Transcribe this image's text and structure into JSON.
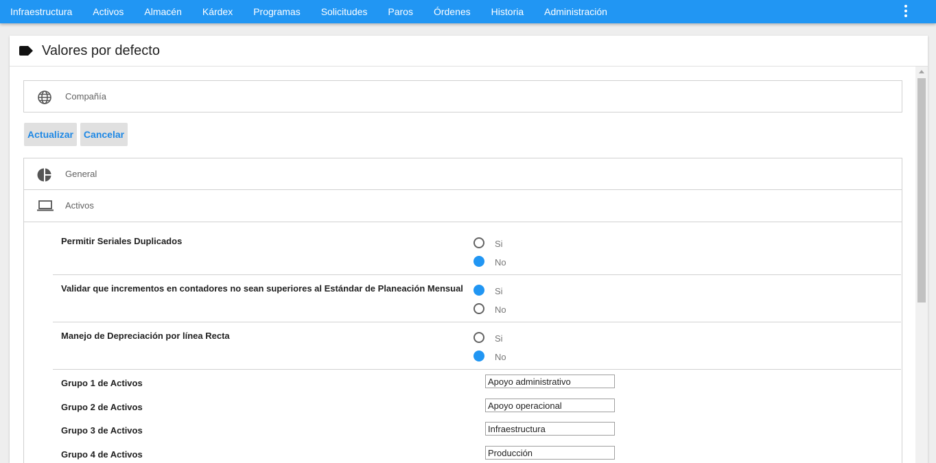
{
  "nav": {
    "items": [
      "Infraestructura",
      "Activos",
      "Almacén",
      "Kárdex",
      "Programas",
      "Solicitudes",
      "Paros",
      "Órdenes",
      "Historia",
      "Administración"
    ]
  },
  "page": {
    "title": "Valores por defecto"
  },
  "company_panel": {
    "label": "Compañía",
    "icon": "globe-icon"
  },
  "actions": {
    "update_label": "Actualizar",
    "cancel_label": "Cancelar"
  },
  "sections": [
    {
      "label": "General",
      "icon": "pie-chart-icon"
    },
    {
      "label": "Activos",
      "icon": "laptop-icon"
    }
  ],
  "asset_settings": [
    {
      "label": "Permitir Seriales Duplicados",
      "options": [
        "Si",
        "No"
      ],
      "selected": "No"
    },
    {
      "label": "Validar que incrementos en contadores no sean superiores al Estándar de Planeación Mensual",
      "options": [
        "Si",
        "No"
      ],
      "selected": "Si"
    },
    {
      "label": "Manejo de Depreciación por línea Recta",
      "options": [
        "Si",
        "No"
      ],
      "selected": "No"
    }
  ],
  "asset_groups": [
    {
      "label": "Grupo 1 de Activos",
      "value": "Apoyo administrativo"
    },
    {
      "label": "Grupo 2 de Activos",
      "value": "Apoyo operacional"
    },
    {
      "label": "Grupo 3 de Activos",
      "value": "Infraestructura"
    },
    {
      "label": "Grupo 4 de Activos",
      "value": "Producción"
    }
  ],
  "colors": {
    "primary": "#2196f3",
    "button_bg": "#e0e0e0",
    "button_text": "#1e88e5"
  }
}
